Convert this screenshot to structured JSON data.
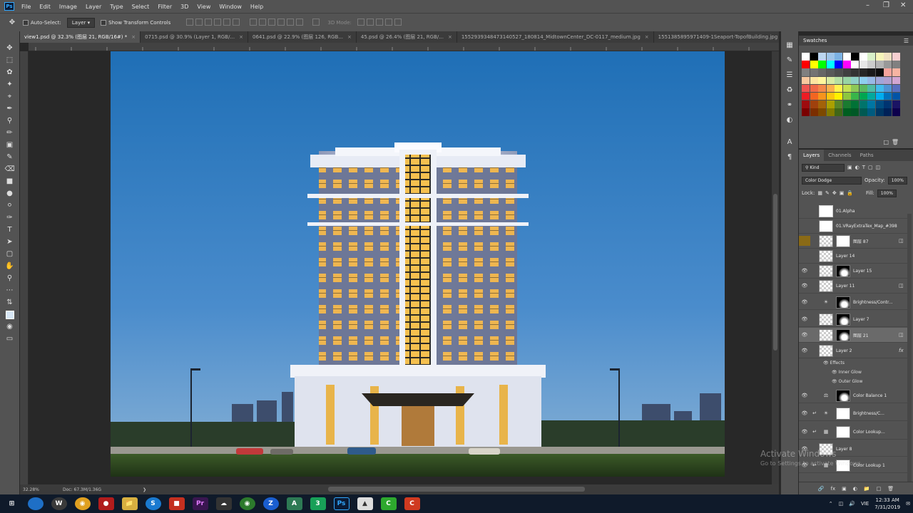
{
  "menu": {
    "items": [
      "File",
      "Edit",
      "Image",
      "Layer",
      "Type",
      "Select",
      "Filter",
      "3D",
      "View",
      "Window",
      "Help"
    ],
    "app_logo": "Ps"
  },
  "options": {
    "auto_select_label": "Auto-Select:",
    "auto_select_value": "Layer",
    "show_transform_label": "Show Transform Controls",
    "mode_3d_label": "3D Mode:"
  },
  "tabs": [
    "view1.psd @ 32.3% (图层 21, RGB/16#) *",
    "0715.psd @ 30.9% (Layer 1, RGB/...",
    "0641.psd @ 22.9% (图层 126, RGB...",
    "45.psd @ 26.4% (图层 21, RGB/...",
    "1552939348473140527_180814_MidtownCenter_DC-0117_medium.jpg",
    "1551385895971409-1Seaport-TopofBuilding.jpg"
  ],
  "status": {
    "zoom": "32.28%",
    "doc": "Doc: 67.3M/1.36G"
  },
  "swatches": {
    "title": "Swatches",
    "colors": [
      "#ffffff",
      "#000000",
      "#bcd6f0",
      "#9ec5ea",
      "#7cb2e4",
      "#ffffff",
      "#000000",
      "#ffffff",
      "#d8f0c8",
      "#f6f4b8",
      "#f0e0c0",
      "#f7cfd0",
      "#ff0000",
      "#ffff00",
      "#00ff00",
      "#00ffff",
      "#0000ff",
      "#ff00ff",
      "#ffffff",
      "#e6e6e6",
      "#cccccc",
      "#b3b3b3",
      "#999999",
      "#808080",
      "#808080",
      "#737373",
      "#666666",
      "#595959",
      "#4d4d4d",
      "#404040",
      "#333333",
      "#262626",
      "#1a1a1a",
      "#0d0d0d",
      "#f6a39b",
      "#f7b4a2",
      "#f9c79e",
      "#fde5a0",
      "#fff69c",
      "#d8eba1",
      "#b6dfa3",
      "#98d4a5",
      "#8fd0c6",
      "#8ecfee",
      "#97b9e6",
      "#a1a5d8",
      "#b19fcf",
      "#d3a6d2",
      "#ef5350",
      "#f06a48",
      "#f4884a",
      "#fbb04d",
      "#fff34e",
      "#c5e152",
      "#8dc956",
      "#5ab860",
      "#4dbca6",
      "#42bbec",
      "#4f93d4",
      "#5a6fc0",
      "#ed1c24",
      "#f26522",
      "#f7941d",
      "#fdc60f",
      "#fff200",
      "#8dc63f",
      "#39b54a",
      "#00a651",
      "#00a99d",
      "#00aeef",
      "#0072bc",
      "#0054a6",
      "#9e0b0f",
      "#a0410d",
      "#a36209",
      "#aba000",
      "#598527",
      "#1a7b30",
      "#007236",
      "#00746b",
      "#0076a3",
      "#004b80",
      "#003471",
      "#1b1464",
      "#790000",
      "#7b2e00",
      "#7d4900",
      "#827b00",
      "#406618",
      "#005e20",
      "#005826",
      "#005952",
      "#005b7f",
      "#003663",
      "#002157",
      "#0d004c"
    ]
  },
  "layers_panel": {
    "tabs": [
      "Layers",
      "Channels",
      "Paths"
    ],
    "kind": "Kind",
    "blend_mode": "Color Dodge",
    "opacity_label": "Opacity:",
    "opacity_value": "100%",
    "lock_label": "Lock:",
    "fill_label": "Fill:",
    "fill_value": "100%",
    "layers": [
      {
        "name": "01.Alpha",
        "visible": false
      },
      {
        "name": "01.VRayExtraTex_Map_#398",
        "visible": false
      },
      {
        "name": "图层 87",
        "visible": false
      },
      {
        "name": "Layer 14",
        "visible": false
      },
      {
        "name": "Layer 15",
        "visible": true
      },
      {
        "name": "Layer 11",
        "visible": true
      },
      {
        "name": "Brightness/Contr...",
        "visible": true
      },
      {
        "name": "Layer 7",
        "visible": true
      },
      {
        "name": "图层 21",
        "visible": true
      },
      {
        "name": "Layer 2",
        "visible": true
      },
      {
        "name": "Color Balance 1",
        "visible": true
      },
      {
        "name": "Brightness/C...",
        "visible": true
      },
      {
        "name": "Color Lookup...",
        "visible": true
      },
      {
        "name": "Layer 8",
        "visible": true
      },
      {
        "name": "Color Lookup 1",
        "visible": true
      }
    ],
    "effects_label": "Effects",
    "effect_inner": "Inner Glow",
    "effect_outer": "Outer Glow",
    "fx_label": "fx"
  },
  "watermark": {
    "line1": "Activate Windows",
    "line2": "Go to Settings to activate Windows."
  },
  "taskbar": {
    "lang": "VIE",
    "time": "12:33 AM",
    "date": "7/31/2019"
  }
}
